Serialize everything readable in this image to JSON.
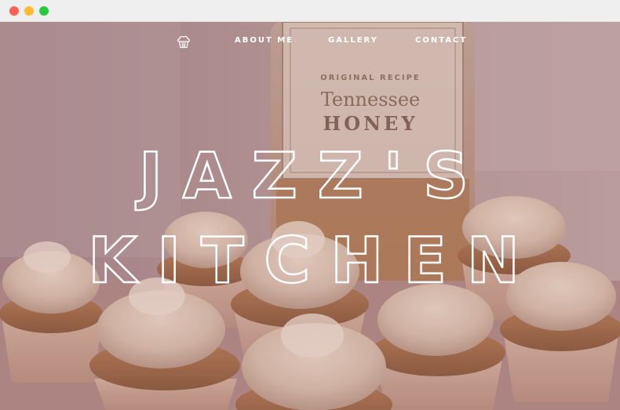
{
  "window": {
    "controls": [
      "close",
      "minimize",
      "maximize"
    ]
  },
  "nav": {
    "logo_icon": "cupcake-icon",
    "items": [
      {
        "label": "ABOUT ME"
      },
      {
        "label": "GALLERY"
      },
      {
        "label": "CONTACT"
      }
    ]
  },
  "hero": {
    "title_line_1": "JAZZ'S",
    "title_line_2": "KITCHEN",
    "bottle_label": {
      "line_1": "ORIGINAL RECIPE",
      "line_2": "Tennessee",
      "line_3": "HONEY"
    }
  },
  "colors": {
    "nav_text": "#ffffff",
    "title_outline": "#ffffff",
    "photo_tint": "#8c5a60"
  }
}
